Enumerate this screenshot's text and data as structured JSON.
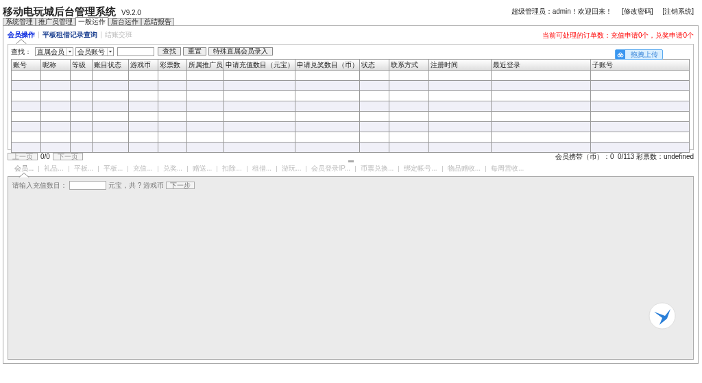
{
  "header": {
    "title": "移动电玩城后台管理系统",
    "version": "V9.2.0",
    "welcome": "超级管理员：admin！欢迎回来！",
    "links": [
      "[修改密码]",
      "[注销系统]"
    ]
  },
  "top_tabs": [
    {
      "label": "系统管理",
      "selected": false
    },
    {
      "label": "推广员管理",
      "selected": false
    },
    {
      "label": "一般运作",
      "selected": true
    },
    {
      "label": "后台运作",
      "selected": false
    },
    {
      "label": "总结报告",
      "selected": false
    }
  ],
  "sub_tabs": [
    {
      "label": "会员操作",
      "selected": true,
      "disabled": false
    },
    {
      "label": "平板租借记录查询",
      "selected": false,
      "disabled": false
    },
    {
      "label": "结账交班",
      "selected": false,
      "disabled": true
    }
  ],
  "notice": "当前可处理的订单数：充值申请0个，兑奖申请0个",
  "upload_button": "拖拽上传",
  "search": {
    "label": "查找：",
    "selects": [
      "直属会员",
      "会员账号"
    ],
    "buttons": [
      "查找",
      "重置",
      "特殊直属会员录入"
    ]
  },
  "table": {
    "columns": [
      "账号",
      "昵称",
      "等级",
      "账目状态",
      "游戏币",
      "彩票数",
      "所属推广员",
      "申请充值数目（元宝）",
      "申请兑奖数目（币）",
      "状态",
      "联系方式",
      "注册时间",
      "最近登录",
      "子账号"
    ]
  },
  "pager": {
    "prev": "上一页",
    "page": "0/0",
    "next": "下一页",
    "summary": "会员携带（币）：0  0/113 彩票数：undefined"
  },
  "lower_tabs": [
    {
      "label": "会员...",
      "selected": true
    },
    {
      "label": "礼品...",
      "selected": false
    },
    {
      "label": "平板...",
      "selected": false
    },
    {
      "label": "平板...",
      "selected": false
    },
    {
      "label": "充值...",
      "selected": false
    },
    {
      "label": "兑奖...",
      "selected": false
    },
    {
      "label": "赠送...",
      "selected": false
    },
    {
      "label": "扣除...",
      "selected": false
    },
    {
      "label": "租借...",
      "selected": false
    },
    {
      "label": "游玩...",
      "selected": false
    },
    {
      "label": "会员登录IP...",
      "selected": false
    },
    {
      "label": "币票兑换...",
      "selected": false
    },
    {
      "label": "绑定帐号...",
      "selected": false
    },
    {
      "label": "物品赠收...",
      "selected": false
    },
    {
      "label": "每周营收...",
      "selected": false
    }
  ],
  "recharge_form": {
    "label": "请输入充值数目：",
    "suffix": "元宝，共 ? 游戏币",
    "button": "下一步"
  }
}
